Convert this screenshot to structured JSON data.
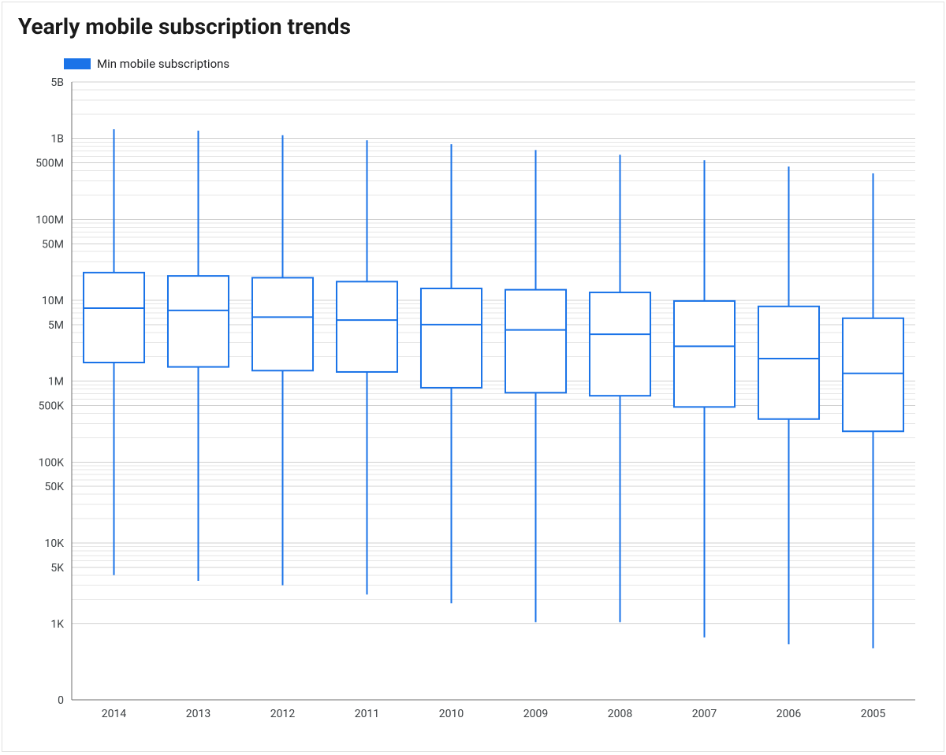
{
  "title": "Yearly mobile subscription trends",
  "legend": {
    "label": "Min mobile subscriptions",
    "color": "#1a73e8"
  },
  "chart_data": {
    "type": "boxplot",
    "y_scale": "log-with-zero",
    "y_ticks": [
      0,
      1000,
      5000,
      10000,
      50000,
      100000,
      500000,
      1000000,
      5000000,
      10000000,
      50000000,
      100000000,
      500000000,
      1000000000,
      5000000000
    ],
    "y_tick_labels": [
      "0",
      "1K",
      "5K",
      "10K",
      "50K",
      "100K",
      "500K",
      "1M",
      "5M",
      "10M",
      "50M",
      "100M",
      "500M",
      "1B",
      "5B"
    ],
    "ylim": [
      0,
      5000000000
    ],
    "categories": [
      "2014",
      "2013",
      "2012",
      "2011",
      "2010",
      "2009",
      "2008",
      "2007",
      "2006",
      "2005"
    ],
    "series": [
      {
        "name": "Min mobile subscriptions",
        "boxes": [
          {
            "min": 4000,
            "q1": 1700000,
            "median": 8000000,
            "q3": 22000000,
            "max": 1300000000
          },
          {
            "min": 3400,
            "q1": 1500000,
            "median": 7500000,
            "q3": 20000000,
            "max": 1250000000
          },
          {
            "min": 3000,
            "q1": 1350000,
            "median": 6200000,
            "q3": 19000000,
            "max": 1100000000
          },
          {
            "min": 2300,
            "q1": 1300000,
            "median": 5700000,
            "q3": 17000000,
            "max": 950000000
          },
          {
            "min": 1800,
            "q1": 830000,
            "median": 5000000,
            "q3": 14000000,
            "max": 850000000
          },
          {
            "min": 1050,
            "q1": 720000,
            "median": 4300000,
            "q3": 13500000,
            "max": 720000000
          },
          {
            "min": 1050,
            "q1": 660000,
            "median": 3800000,
            "q3": 12500000,
            "max": 630000000
          },
          {
            "min": 680,
            "q1": 480000,
            "median": 2700000,
            "q3": 9800000,
            "max": 540000000
          },
          {
            "min": 560,
            "q1": 340000,
            "median": 1900000,
            "q3": 8400000,
            "max": 450000000
          },
          {
            "min": 500,
            "q1": 240000,
            "median": 1250000,
            "q3": 6000000,
            "max": 370000000
          }
        ]
      }
    ]
  }
}
